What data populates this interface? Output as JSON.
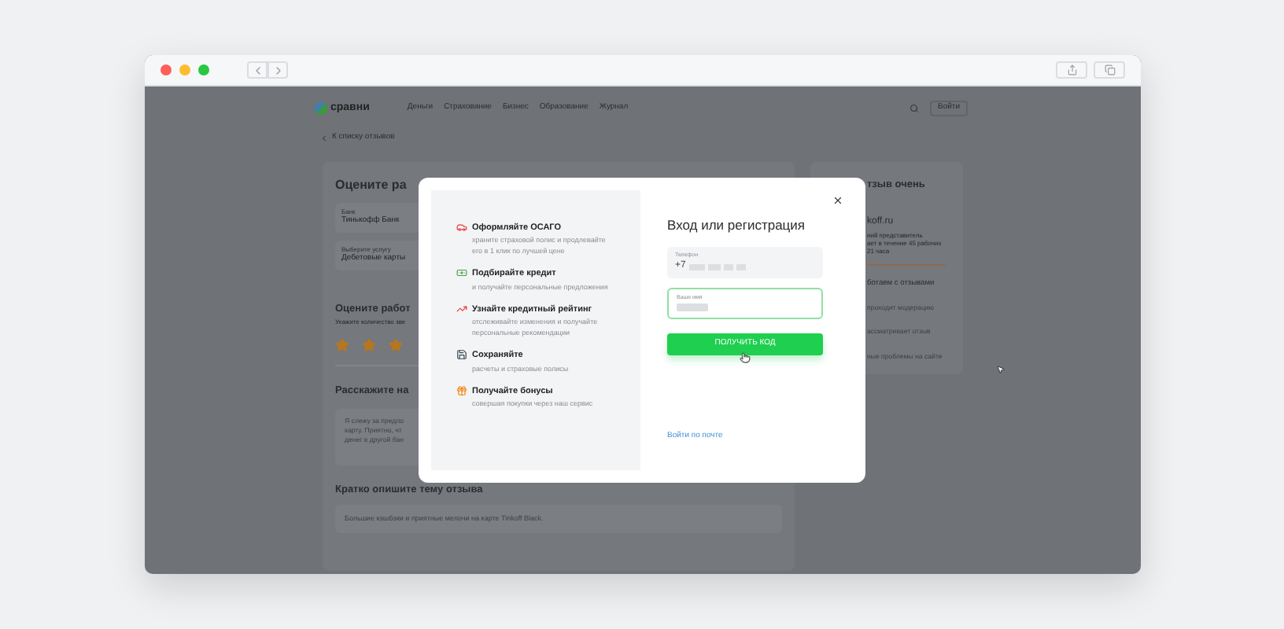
{
  "header": {
    "logo": "сравни",
    "nav": [
      {
        "label": "Деньги"
      },
      {
        "label": "Страхование"
      },
      {
        "label": "Бизнес"
      },
      {
        "label": "Образование"
      },
      {
        "label": "Журнал"
      }
    ],
    "login": "Войти"
  },
  "back_link": "К списку отзывов",
  "review_form": {
    "title": "Оцените ра",
    "fields": [
      {
        "label": "Банк",
        "value": "Тинькофф Банк"
      },
      {
        "label": "Выберите услугу",
        "value": "Дебетовые карты"
      }
    ],
    "rating_title": "Оцените работ",
    "rating_hint": "Укажите количество зве",
    "stars": 3,
    "story_title": "Расскажите на",
    "story_lines": [
      "Я слежу за предло",
      "карту. Приятно, чт",
      "денег в другой бан"
    ],
    "topic_title": "Кратко опишите тему отзыва",
    "topic_value": "Большие кэшбэки и приятные мелочи на карте Tinkoff Black."
  },
  "side_card": {
    "title": "тзыв очень",
    "site": "koff.ru",
    "info_lines": [
      "ний представитель",
      "ает в течение 45 рабочих",
      "21 часа"
    ],
    "steps_title": "ботаем с отзывами",
    "steps": [
      "проходит модерацию",
      "ассматривает отзыв",
      "ные проблемы на сайте"
    ]
  },
  "modal": {
    "benefits": [
      {
        "kind": "car",
        "title": "Оформляйте ОСАГО",
        "text": "храните страховой полис и продлевайте его в 1 клик по лучшей цене"
      },
      {
        "kind": "money",
        "title": "Подбирайте кредит",
        "text": "и получайте персональные предложения"
      },
      {
        "kind": "chart",
        "title": "Узнайте кредитный рейтинг",
        "text": "отслеживайте изменения и получайте персональные рекомендации"
      },
      {
        "kind": "save",
        "title": "Сохраняйте",
        "text": "расчеты и страховые полисы"
      },
      {
        "kind": "gift",
        "title": "Получайте бонусы",
        "text": "совершая покупки через наш сервис"
      }
    ],
    "title": "Вход или регистрация",
    "phone": {
      "label": "Телефон",
      "value": "+7"
    },
    "name": {
      "label": "Ваше имя",
      "focused": true
    },
    "submit": "ПОЛУЧИТЬ КОД",
    "email_link": "Войти по почте"
  }
}
